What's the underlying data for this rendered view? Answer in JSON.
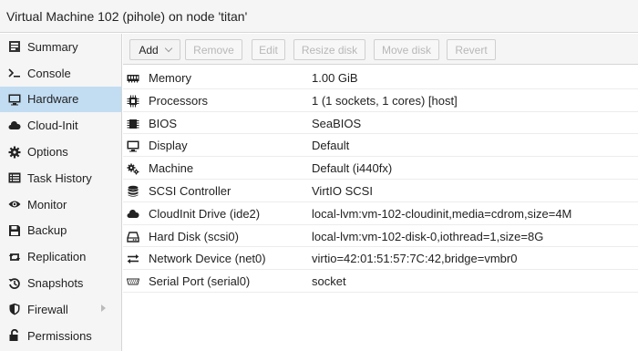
{
  "window": {
    "title": "Virtual Machine 102 (pihole) on node 'titan'"
  },
  "sidebar": {
    "items": [
      {
        "label": "Summary",
        "icon": "summary-icon"
      },
      {
        "label": "Console",
        "icon": "console-icon"
      },
      {
        "label": "Hardware",
        "icon": "monitor-icon",
        "active": true
      },
      {
        "label": "Cloud-Init",
        "icon": "cloud-icon"
      },
      {
        "label": "Options",
        "icon": "gear-icon"
      },
      {
        "label": "Task History",
        "icon": "list-icon"
      },
      {
        "label": "Monitor",
        "icon": "eye-icon"
      },
      {
        "label": "Backup",
        "icon": "floppy-icon"
      },
      {
        "label": "Replication",
        "icon": "retweet-icon"
      },
      {
        "label": "Snapshots",
        "icon": "history-icon"
      },
      {
        "label": "Firewall",
        "icon": "shield-icon"
      },
      {
        "label": "Permissions",
        "icon": "unlock-icon"
      }
    ]
  },
  "toolbar": {
    "add": "Add",
    "remove": "Remove",
    "edit": "Edit",
    "resize": "Resize disk",
    "move": "Move disk",
    "revert": "Revert"
  },
  "hardware": {
    "rows": [
      {
        "name": "Memory",
        "value": "1.00 GiB",
        "icon": "memory-icon"
      },
      {
        "name": "Processors",
        "value": "1 (1 sockets, 1 cores) [host]",
        "icon": "cpu-icon"
      },
      {
        "name": "BIOS",
        "value": "SeaBIOS",
        "icon": "chip-icon"
      },
      {
        "name": "Display",
        "value": "Default",
        "icon": "desktop-icon"
      },
      {
        "name": "Machine",
        "value": "Default (i440fx)",
        "icon": "cogs-icon"
      },
      {
        "name": "SCSI Controller",
        "value": "VirtIO SCSI",
        "icon": "database-icon"
      },
      {
        "name": "CloudInit Drive (ide2)",
        "value": "local-lvm:vm-102-cloudinit,media=cdrom,size=4M",
        "icon": "cloud-icon"
      },
      {
        "name": "Hard Disk (scsi0)",
        "value": "local-lvm:vm-102-disk-0,iothread=1,size=8G",
        "icon": "hdd-icon"
      },
      {
        "name": "Network Device (net0)",
        "value": "virtio=42:01:51:57:7C:42,bridge=vmbr0",
        "icon": "exchange-icon"
      },
      {
        "name": "Serial Port (serial0)",
        "value": "socket",
        "icon": "serial-icon"
      }
    ]
  }
}
